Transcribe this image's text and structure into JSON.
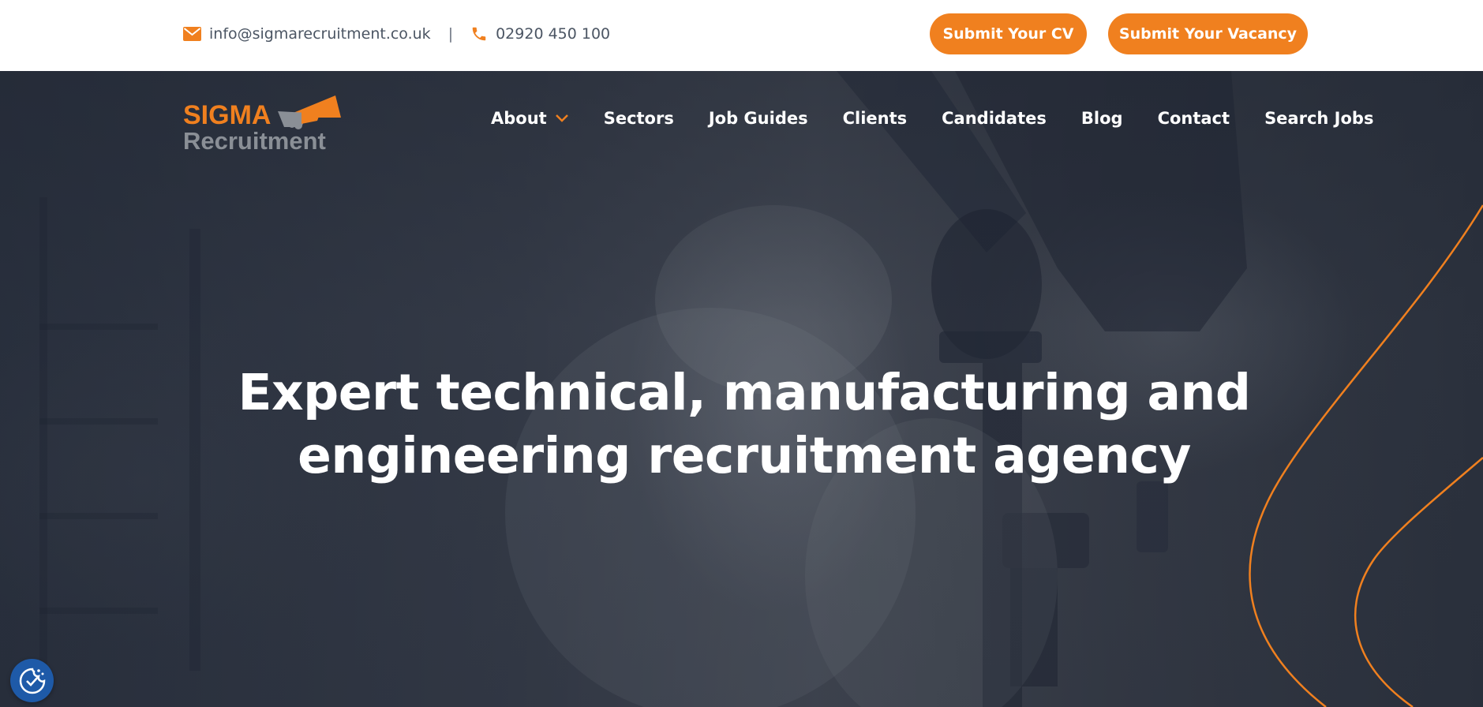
{
  "topbar": {
    "email": "info@sigmarecruitment.co.uk",
    "separator": "|",
    "phone": "02920 450 100",
    "email_icon": "envelope-icon",
    "phone_icon": "phone-icon",
    "submit_cv_label": "Submit Your CV",
    "submit_vacancy_label": "Submit Your Vacancy"
  },
  "logo": {
    "word1": "SIGMA",
    "word2": "Recruitment",
    "icon": "handshake-triangle-icon"
  },
  "nav": {
    "items": [
      {
        "label": "About",
        "has_dropdown": true
      },
      {
        "label": "Sectors"
      },
      {
        "label": "Job Guides"
      },
      {
        "label": "Clients"
      },
      {
        "label": "Candidates"
      },
      {
        "label": "Blog"
      },
      {
        "label": "Contact"
      },
      {
        "label": "Search Jobs"
      }
    ]
  },
  "hero": {
    "headline_line1": "Expert technical, manufacturing and",
    "headline_line2": "engineering recruitment agency"
  },
  "cookie": {
    "icon": "cookie-consent-icon"
  },
  "colors": {
    "accent": "#f0801f",
    "logo_grey": "#8a8f96",
    "hero_bg": "#2f3542",
    "cookie_blue": "#1e5aa8"
  }
}
